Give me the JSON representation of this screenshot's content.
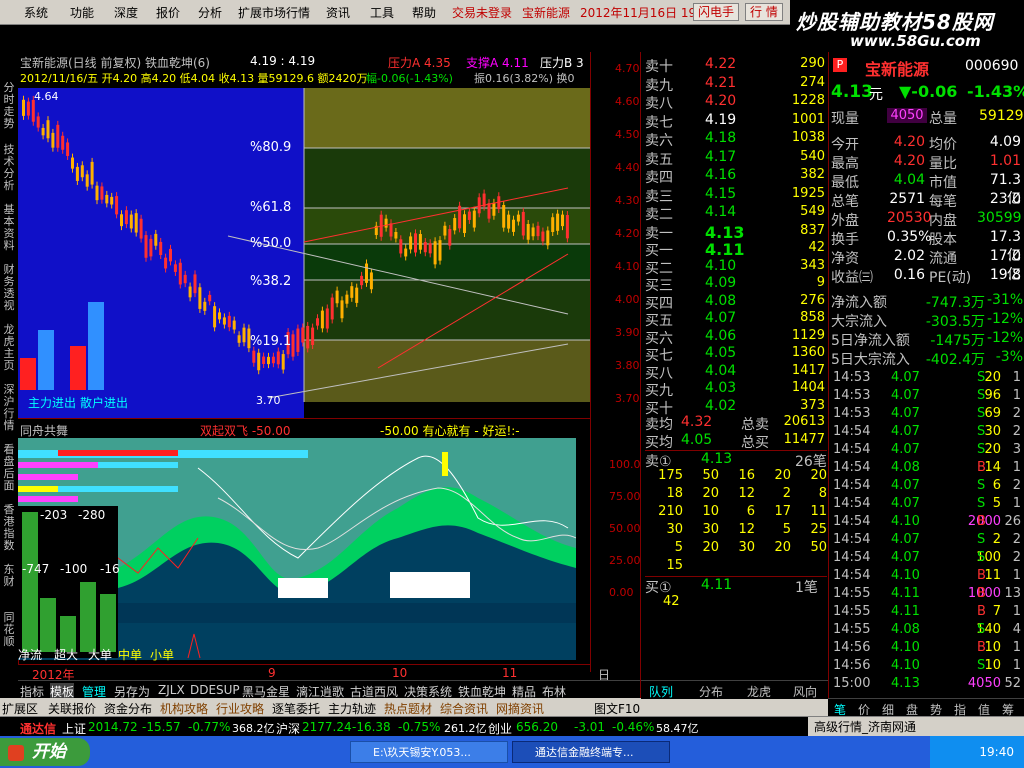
{
  "menu": {
    "items": [
      "系统",
      "功能",
      "深度",
      "报价",
      "分析",
      "扩展市场行情",
      "资讯",
      "工具",
      "帮助"
    ],
    "status_login": "交易未登录",
    "status_stock": "宝新能源",
    "status_date": "2012年11月16日 19:",
    "btn_flash": "闪电手",
    "btn_quote": "行 情"
  },
  "banner": {
    "title": "炒股辅助教材58股网",
    "url": "www.58Gu.com"
  },
  "left_tabs": [
    "分时走势",
    "技术分析",
    "基本资料",
    "财务透视",
    "龙虎主页",
    "深沪行情",
    "看盘后面",
    "香港指数",
    "东财",
    "同花顺"
  ],
  "chart_header": {
    "line1": "宝新能源(日线 前复权) 铁血乾坤(6)",
    "line1_vals": "4.19 : 4.19",
    "pressure": "压力A 4.35",
    "support": "支撑A 4.11",
    "pressure_b": "压力B 3",
    "line2": "2012/11/16/五 开4.20 高4.20 低4.04 收4.13 量59129.6 额2420万",
    "line2_change": "幅-0.06(-1.43%)",
    "line2_tail": "振0.16(3.82%) 换0"
  },
  "kchart": {
    "fib_labels": [
      "%80.9",
      "%61.8",
      "%50.0",
      "%38.2",
      "%19.1"
    ],
    "high_label": "4.64",
    "low_label": "3.70",
    "legend_main": "主力进出",
    "legend_retail": "散户进出"
  },
  "y_axis": {
    "ticks": [
      "4.70",
      "4.60",
      "4.50",
      "4.40",
      "4.30",
      "4.20",
      "4.10",
      "4.00",
      "3.90",
      "3.80",
      "3.70"
    ],
    "sub_ticks": [
      "100.0",
      "75.00",
      "50.00",
      "25.00",
      "0.00"
    ]
  },
  "sub_header": {
    "title": "同舟共舞",
    "mid": "双起双飞 -50.00",
    "right": "-50.00  有心就有 - 好运!:-"
  },
  "sub_inset": {
    "v1": "-203",
    "v2": "-280",
    "v3": "-747",
    "v4": "-100",
    "v5": "-16"
  },
  "sub_legend": [
    "净流",
    "超大",
    "大单",
    "中单",
    "小单"
  ],
  "x_axis": {
    "labels": [
      "2012年",
      "9",
      "10",
      "11"
    ],
    "period": "日线"
  },
  "bottom_tabs": [
    "指标",
    "模板",
    "管理",
    "另存为",
    "ZJLX",
    "DDE",
    "SUP",
    "黑马金星",
    "漓江逍歌",
    "古道西风",
    "决策系统",
    "铁血乾坤",
    "精品",
    "布林"
  ],
  "row2_tabs": [
    "扩展区",
    "关联报价",
    "资金分布",
    "机构攻略",
    "行业攻略",
    "逐笔委托",
    "主力轨迹",
    "热点题材",
    "综合资讯",
    "网摘资讯",
    "图文F10"
  ],
  "orderbook": {
    "sell": [
      {
        "label": "卖十",
        "price": "4.22",
        "vol": "290"
      },
      {
        "label": "卖九",
        "price": "4.21",
        "vol": "274"
      },
      {
        "label": "卖八",
        "price": "4.20",
        "vol": "1228"
      },
      {
        "label": "卖七",
        "price": "4.19",
        "vol": "1001"
      },
      {
        "label": "卖六",
        "price": "4.18",
        "vol": "1038"
      },
      {
        "label": "卖五",
        "price": "4.17",
        "vol": "540"
      },
      {
        "label": "卖四",
        "price": "4.16",
        "vol": "382"
      },
      {
        "label": "卖三",
        "price": "4.15",
        "vol": "1925"
      },
      {
        "label": "卖二",
        "price": "4.14",
        "vol": "549"
      },
      {
        "label": "卖一",
        "price": "4.13",
        "vol": "837"
      }
    ],
    "buy": [
      {
        "label": "买一",
        "price": "4.11",
        "vol": "42"
      },
      {
        "label": "买二",
        "price": "4.10",
        "vol": "343"
      },
      {
        "label": "买三",
        "price": "4.09",
        "vol": "9"
      },
      {
        "label": "买四",
        "price": "4.08",
        "vol": "276"
      },
      {
        "label": "买五",
        "price": "4.07",
        "vol": "858"
      },
      {
        "label": "买六",
        "price": "4.06",
        "vol": "1129"
      },
      {
        "label": "买七",
        "price": "4.05",
        "vol": "1360"
      },
      {
        "label": "买八",
        "price": "4.04",
        "vol": "1417"
      },
      {
        "label": "买九",
        "price": "4.03",
        "vol": "1404"
      },
      {
        "label": "买十",
        "price": "4.02",
        "vol": "373"
      }
    ],
    "avg_sell_label": "卖均",
    "avg_sell": "4.32",
    "total_sell_label": "总卖",
    "total_sell": "20613",
    "avg_buy_label": "买均",
    "avg_buy": "4.05",
    "total_buy_label": "总买",
    "total_buy": "11477",
    "queue_sell_label": "卖①",
    "queue_sell_price": "4.13",
    "queue_sell_count": "26笔",
    "queue_rows": [
      [
        "175",
        "50",
        "16",
        "20",
        "20"
      ],
      [
        "18",
        "20",
        "12",
        "2",
        "8"
      ],
      [
        "210",
        "10",
        "6",
        "17",
        "11"
      ],
      [
        "30",
        "30",
        "12",
        "5",
        "25"
      ],
      [
        "5",
        "20",
        "30",
        "20",
        "50"
      ],
      [
        "15",
        "",
        "",
        "",
        ""
      ]
    ],
    "queue_buy_label": "买①",
    "queue_buy_price": "4.11",
    "queue_buy_count": "1笔",
    "queue_buy_vol": "42",
    "bottom_tabs": [
      "队列",
      "分布",
      "龙虎",
      "风向"
    ]
  },
  "quote": {
    "name": "宝新能源",
    "code": "000690",
    "price": "4.13",
    "unit": "元",
    "change": "▼-0.06",
    "pct": "-1.43%",
    "now_vol_label": "现量",
    "now_vol": "4050",
    "total_vol_label": "总量",
    "total_vol": "59129",
    "fields": [
      [
        "今开",
        "4.20",
        "均价",
        "4.09"
      ],
      [
        "最高",
        "4.20",
        "量比",
        "1.01"
      ],
      [
        "最低",
        "4.04",
        "市值",
        "71.3亿"
      ],
      [
        "总笔",
        "2571",
        "每笔",
        "23.0"
      ],
      [
        "外盘",
        "20530",
        "内盘",
        "30599"
      ],
      [
        "换手",
        "0.35%",
        "股本",
        "17.3亿"
      ],
      [
        "净资",
        "2.02",
        "流通",
        "17.0亿"
      ],
      [
        "收益㈢",
        "0.16",
        "PE(动)",
        "19.8"
      ]
    ],
    "flows": [
      [
        "净流入额",
        "-747.3万",
        "-31%"
      ],
      [
        "大宗流入",
        "-303.5万",
        "-12%"
      ],
      [
        "5日净流入额",
        "-1475万",
        "-12%"
      ],
      [
        "5日大宗流入",
        "-402.4万",
        "-3%"
      ]
    ],
    "ticks": [
      [
        "14:53",
        "4.07",
        "20",
        "S",
        "1"
      ],
      [
        "14:53",
        "4.07",
        "96",
        "S",
        "1"
      ],
      [
        "14:53",
        "4.07",
        "69",
        "S",
        "2"
      ],
      [
        "14:54",
        "4.07",
        "30",
        "S",
        "2"
      ],
      [
        "14:54",
        "4.07",
        "20",
        "S",
        "3"
      ],
      [
        "14:54",
        "4.08",
        "14",
        "B",
        "1"
      ],
      [
        "14:54",
        "4.07",
        "6",
        "S",
        "2"
      ],
      [
        "14:54",
        "4.07",
        "5",
        "S",
        "1"
      ],
      [
        "14:54",
        "4.10",
        "2000",
        "B",
        "26"
      ],
      [
        "14:54",
        "4.07",
        "2",
        "S",
        "2"
      ],
      [
        "14:54",
        "4.07",
        "100",
        "S",
        "2"
      ],
      [
        "14:54",
        "4.10",
        "11",
        "B",
        "1"
      ],
      [
        "14:55",
        "4.11",
        "1000",
        "B",
        "13"
      ],
      [
        "14:55",
        "4.11",
        "7",
        "B",
        "1"
      ],
      [
        "14:55",
        "4.08",
        "140",
        "S",
        "4"
      ],
      [
        "14:56",
        "4.10",
        "10",
        "B",
        "1"
      ],
      [
        "14:56",
        "4.10",
        "10",
        "S",
        "1"
      ],
      [
        "15:00",
        "4.13",
        "4050",
        "",
        "52"
      ]
    ],
    "bottom_tabs": [
      "笔",
      "价",
      "细",
      "盘",
      "势",
      "指",
      "值",
      "筹"
    ]
  },
  "ticker": {
    "brand": "通达信",
    "sh_label": "上证",
    "sh": "2014.72",
    "sh_chg": "-15.57",
    "sh_pct": "-0.77%",
    "sh_amt": "368.2亿",
    "sz_label": "沪深",
    "sz": "2177.24",
    "sz_chg": "-16.38",
    "sz_pct": "-0.75%",
    "sz_amt": "261.2亿",
    "cy_label": "创业",
    "cy": "656.20",
    "cy_chg": "-3.01",
    "cy_pct": "-0.46%",
    "cy_amt": "58.47亿",
    "right": "高级行情_济南网通"
  },
  "taskbar": {
    "start": "开始",
    "task1": "E:\\玖天锡安Y.053...",
    "task2": "通达信金融终端专...",
    "time": "19:40"
  },
  "colors": {
    "up": "#ff3030",
    "down": "#00e000",
    "volume": "#ffff00",
    "frame": "#800000"
  }
}
